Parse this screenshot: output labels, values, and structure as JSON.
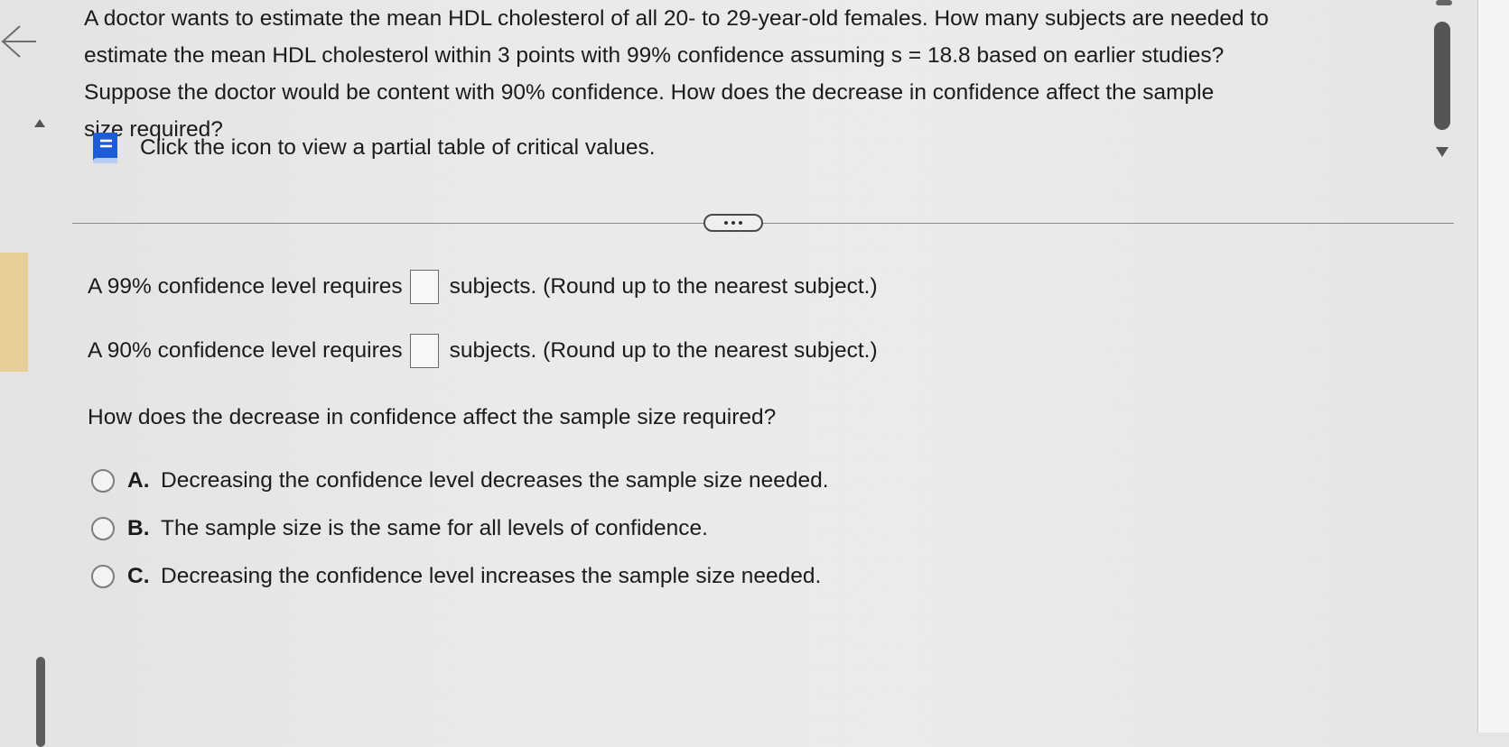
{
  "question": {
    "lines": [
      "A doctor wants to estimate the mean HDL cholesterol of all 20- to 29-year-old females. How many subjects are needed to",
      "estimate the mean HDL cholesterol within 3 points with 99% confidence assuming s = 18.8 based on earlier studies?",
      "Suppose the doctor would be content with 90% confidence. How does the decrease in confidence affect the sample",
      "size required?"
    ]
  },
  "hint": {
    "text": "Click the icon to view a partial table of critical values.",
    "icon": "book-icon"
  },
  "more_button": {
    "icon": "more-dots-icon"
  },
  "answers": [
    {
      "prefix": "A 99% confidence level requires",
      "value": "",
      "suffix": "subjects. (Round up to the nearest subject.)"
    },
    {
      "prefix": "A 90% confidence level requires",
      "value": "",
      "suffix": "subjects. (Round up to the nearest subject.)"
    }
  ],
  "sub_question": "How does the decrease in confidence affect the sample size required?",
  "options": [
    {
      "letter": "A.",
      "text": "Decreasing the confidence level decreases the sample size needed."
    },
    {
      "letter": "B.",
      "text": "The sample size is the same for all levels of confidence."
    },
    {
      "letter": "C.",
      "text": "Decreasing the confidence level increases the sample size needed."
    }
  ],
  "colors": {
    "hint_icon": "#1e5bd8",
    "background": "#ebeae8",
    "left_highlight": "#e8cf9a"
  }
}
